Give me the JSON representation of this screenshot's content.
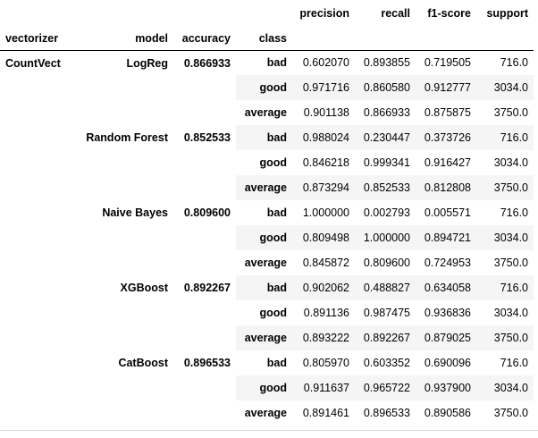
{
  "table": {
    "header_top": [
      "precision",
      "recall",
      "f1-score",
      "support"
    ],
    "index_names": {
      "vectorizer": "vectorizer",
      "model": "model",
      "accuracy": "accuracy",
      "class": "class"
    },
    "vectorizer": "CountVect",
    "groups": [
      {
        "model": "LogReg",
        "accuracy": "0.866933",
        "rows": [
          {
            "class": "bad",
            "precision": "0.602070",
            "recall": "0.893855",
            "f1": "0.719505",
            "support": "716.0"
          },
          {
            "class": "good",
            "precision": "0.971716",
            "recall": "0.860580",
            "f1": "0.912777",
            "support": "3034.0"
          },
          {
            "class": "average",
            "precision": "0.901138",
            "recall": "0.866933",
            "f1": "0.875875",
            "support": "3750.0"
          }
        ]
      },
      {
        "model": "Random Forest",
        "accuracy": "0.852533",
        "rows": [
          {
            "class": "bad",
            "precision": "0.988024",
            "recall": "0.230447",
            "f1": "0.373726",
            "support": "716.0"
          },
          {
            "class": "good",
            "precision": "0.846218",
            "recall": "0.999341",
            "f1": "0.916427",
            "support": "3034.0"
          },
          {
            "class": "average",
            "precision": "0.873294",
            "recall": "0.852533",
            "f1": "0.812808",
            "support": "3750.0"
          }
        ]
      },
      {
        "model": "Naive Bayes",
        "accuracy": "0.809600",
        "rows": [
          {
            "class": "bad",
            "precision": "1.000000",
            "recall": "0.002793",
            "f1": "0.005571",
            "support": "716.0"
          },
          {
            "class": "good",
            "precision": "0.809498",
            "recall": "1.000000",
            "f1": "0.894721",
            "support": "3034.0"
          },
          {
            "class": "average",
            "precision": "0.845872",
            "recall": "0.809600",
            "f1": "0.724953",
            "support": "3750.0"
          }
        ]
      },
      {
        "model": "XGBoost",
        "accuracy": "0.892267",
        "rows": [
          {
            "class": "bad",
            "precision": "0.902062",
            "recall": "0.488827",
            "f1": "0.634058",
            "support": "716.0"
          },
          {
            "class": "good",
            "precision": "0.891136",
            "recall": "0.987475",
            "f1": "0.936836",
            "support": "3034.0"
          },
          {
            "class": "average",
            "precision": "0.893222",
            "recall": "0.892267",
            "f1": "0.879025",
            "support": "3750.0"
          }
        ]
      },
      {
        "model": "CatBoost",
        "accuracy": "0.896533",
        "rows": [
          {
            "class": "bad",
            "precision": "0.805970",
            "recall": "0.603352",
            "f1": "0.690096",
            "support": "716.0"
          },
          {
            "class": "good",
            "precision": "0.911637",
            "recall": "0.965722",
            "f1": "0.937900",
            "support": "3034.0"
          },
          {
            "class": "average",
            "precision": "0.891461",
            "recall": "0.896533",
            "f1": "0.890586",
            "support": "3750.0"
          }
        ]
      }
    ]
  },
  "colors": {
    "stripe": "#f5f5f5",
    "header_rule": "#000000",
    "text": "#000000"
  }
}
